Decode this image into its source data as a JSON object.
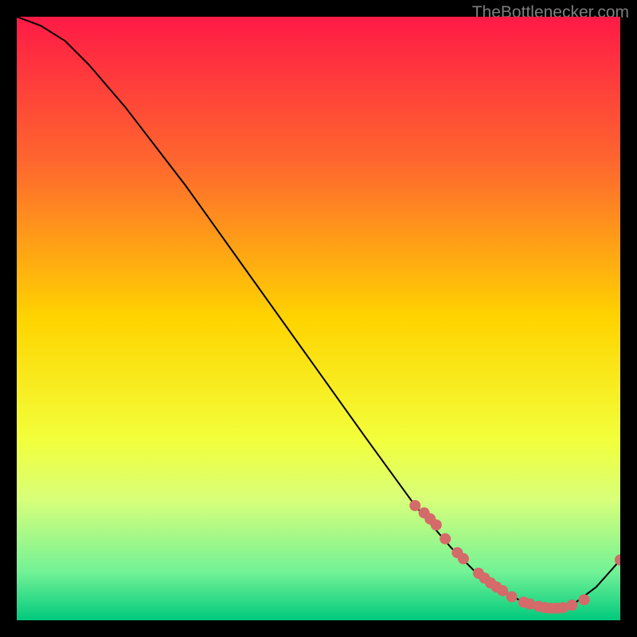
{
  "attribution": "TheBottlenecker.com",
  "chart_data": {
    "type": "line",
    "title": "",
    "xlabel": "",
    "ylabel": "",
    "xlim": [
      0,
      100
    ],
    "ylim": [
      0,
      100
    ],
    "grid": false,
    "legend": false,
    "gradient_stops": [
      {
        "offset": 0,
        "color": "#ff1a46"
      },
      {
        "offset": 0.25,
        "color": "#ff6a2d"
      },
      {
        "offset": 0.5,
        "color": "#ffd400"
      },
      {
        "offset": 0.7,
        "color": "#f2ff3a"
      },
      {
        "offset": 0.8,
        "color": "#d8ff7a"
      },
      {
        "offset": 0.92,
        "color": "#72f296"
      },
      {
        "offset": 1.0,
        "color": "#00c97c"
      }
    ],
    "series": [
      {
        "name": "curve",
        "type": "line",
        "color": "#000000",
        "x": [
          0,
          4,
          8,
          12,
          18,
          28,
          38,
          48,
          58,
          66,
          72,
          76,
          80,
          84,
          88,
          92,
          96,
          100
        ],
        "y": [
          100,
          98.5,
          96,
          92,
          85,
          72,
          58,
          44,
          30,
          19,
          12,
          8,
          5,
          3,
          2,
          2.5,
          5.5,
          10
        ]
      },
      {
        "name": "markers",
        "type": "scatter",
        "color": "#d46a6a",
        "x": [
          66,
          67.5,
          68.5,
          69.5,
          71,
          73,
          74,
          76.5,
          77.5,
          78.5,
          79.5,
          80.5,
          82,
          84,
          85,
          86.5,
          87.5,
          88.5,
          89.5,
          90.5,
          92,
          94,
          100
        ],
        "y": [
          19,
          17.8,
          16.8,
          15.8,
          13.5,
          11.2,
          10.2,
          7.8,
          7.0,
          6.2,
          5.5,
          4.9,
          3.9,
          3.0,
          2.7,
          2.3,
          2.1,
          2.0,
          2.0,
          2.1,
          2.5,
          3.4,
          10
        ]
      }
    ]
  }
}
